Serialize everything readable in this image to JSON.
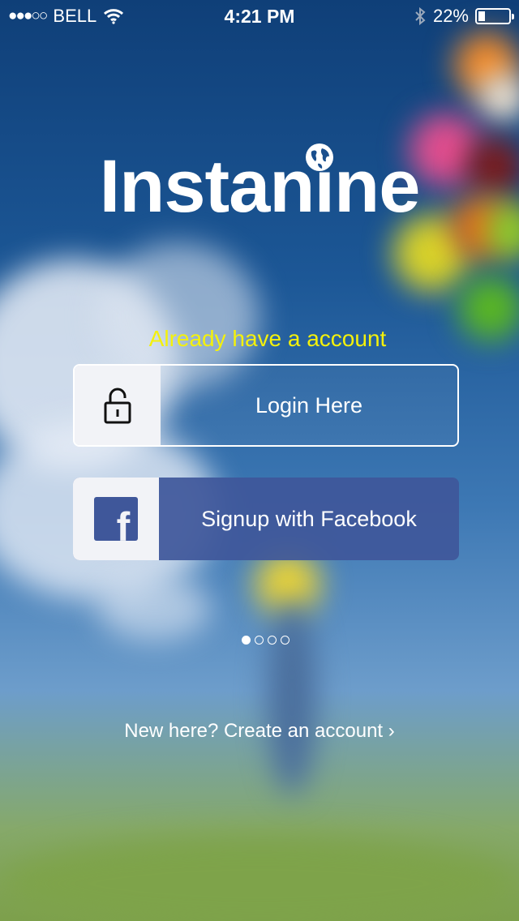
{
  "status_bar": {
    "signal": "●●●○○",
    "carrier": "BELL",
    "time": "4:21 PM",
    "battery_text": "22%",
    "battery_level": 0.22
  },
  "logo": {
    "text": "Instanine"
  },
  "login": {
    "prompt": "Already have a account",
    "login_label": "Login Here",
    "facebook_label": "Signup with Facebook",
    "facebook_letter": "f"
  },
  "pager": {
    "pages": 4,
    "active": 0
  },
  "footer": {
    "create_account": "New here? Create an account ›"
  },
  "colors": {
    "accent_yellow": "#f4f10b",
    "facebook_blue": "#3f579a",
    "icon_box": "#f2f3f7"
  },
  "icons": {
    "wifi": "wifi-icon",
    "bluetooth": "bluetooth-icon",
    "battery": "battery-icon",
    "globe": "globe-icon",
    "lock": "lock-icon",
    "facebook": "facebook-icon"
  }
}
